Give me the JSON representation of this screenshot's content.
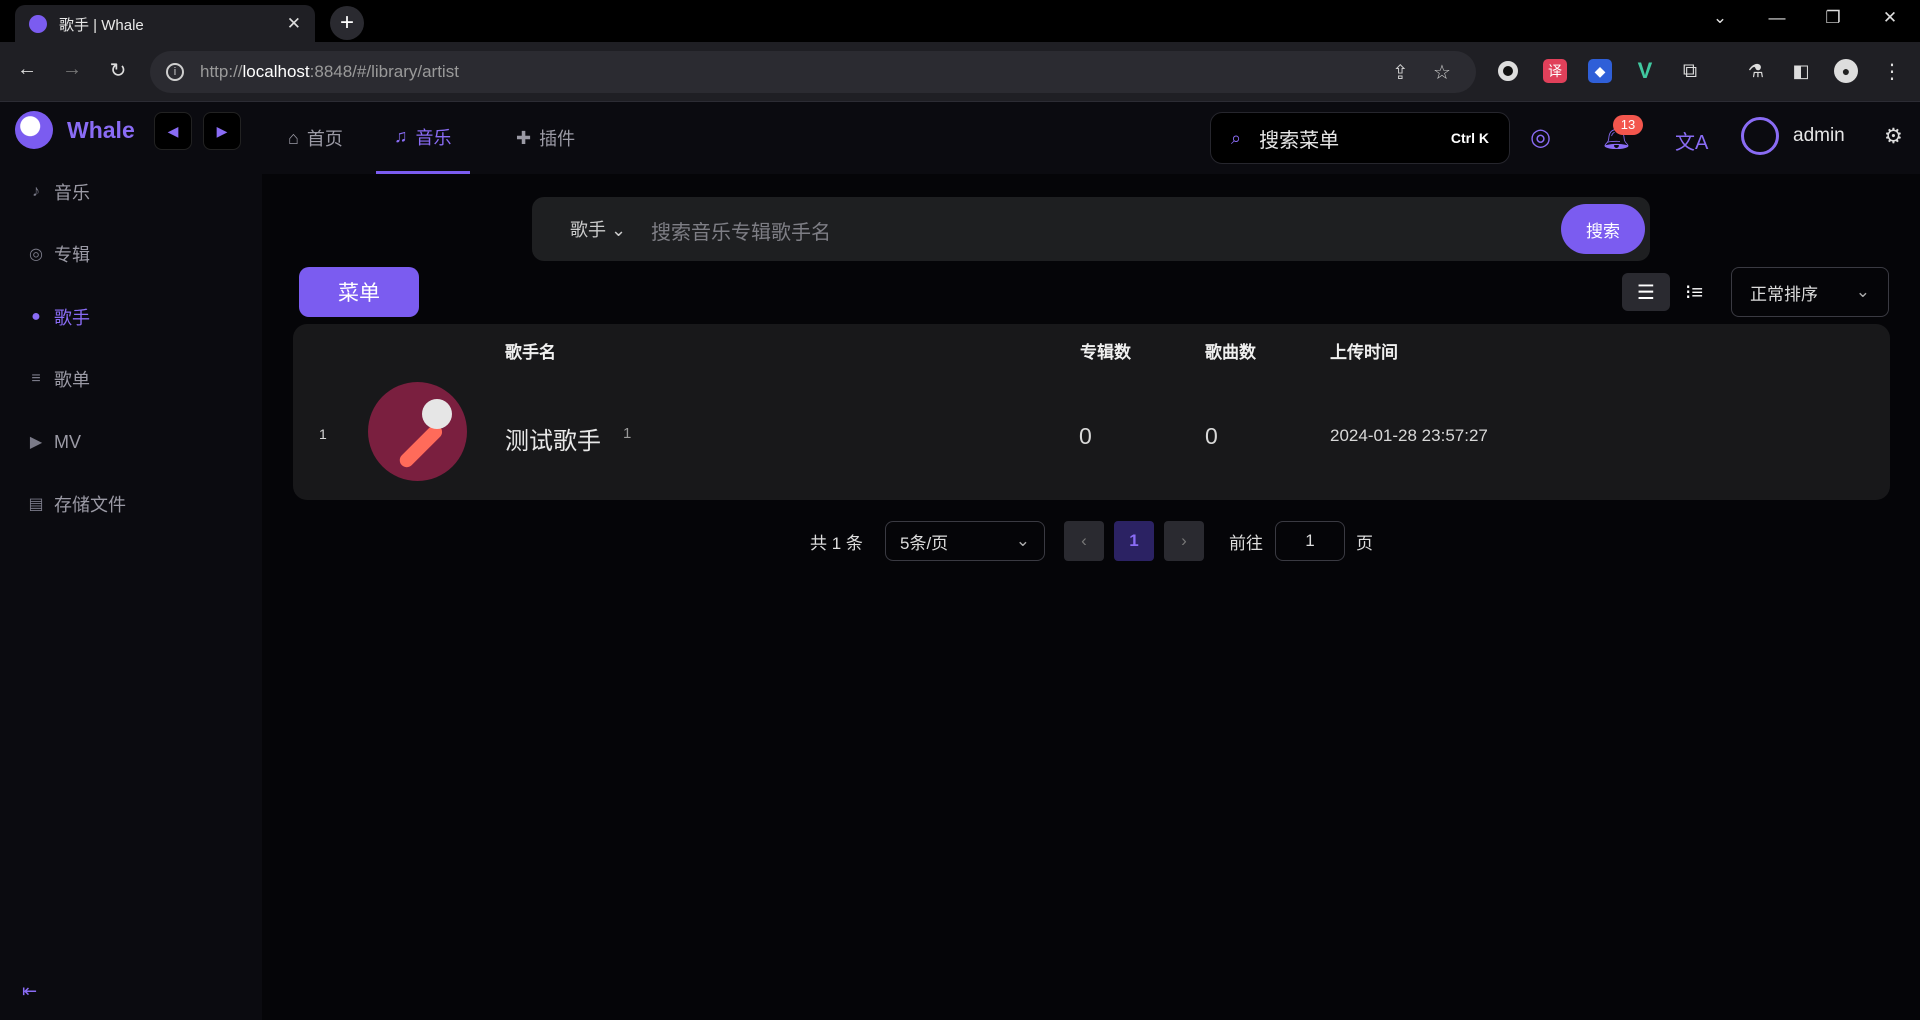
{
  "browser": {
    "tab_title": "歌手 | Whale",
    "url_proto": "http://",
    "url_host": "localhost",
    "url_rest": ":8848/#/library/artist"
  },
  "app": {
    "brand": "Whale",
    "topnav": [
      {
        "label": "首页",
        "icon": "home-icon"
      },
      {
        "label": "音乐",
        "icon": "music-icon"
      },
      {
        "label": "插件",
        "icon": "plugin-icon"
      }
    ],
    "search_menu": {
      "label": "搜索菜单",
      "shortcut": "Ctrl K"
    },
    "notifications": "13",
    "user": "admin"
  },
  "sidebar": {
    "items": [
      {
        "label": "音乐",
        "icon": "music-icon"
      },
      {
        "label": "专辑",
        "icon": "album-icon"
      },
      {
        "label": "歌手",
        "icon": "user-icon"
      },
      {
        "label": "歌单",
        "icon": "playlist-icon"
      },
      {
        "label": "MV",
        "icon": "video-icon"
      },
      {
        "label": "存储文件",
        "icon": "folder-icon"
      }
    ],
    "active": "歌手"
  },
  "search": {
    "type": "歌手",
    "placeholder": "搜索音乐专辑歌手名",
    "button": "搜索"
  },
  "toolbar": {
    "menu_button": "菜单",
    "sort": "正常排序"
  },
  "table": {
    "headers": {
      "name": "歌手名",
      "albums": "专辑数",
      "songs": "歌曲数",
      "uploaded": "上传时间"
    },
    "rows": [
      {
        "index": "1",
        "name": "测试歌手",
        "alias_count": "1",
        "albums": "0",
        "songs": "0",
        "uploaded": "2024-01-28 23:57:27"
      }
    ]
  },
  "pagination": {
    "total": "共 1 条",
    "page_size": "5条/页",
    "current": "1",
    "goto_label": "前往",
    "goto_value": "1",
    "page_suffix": "页"
  },
  "colors": {
    "accent": "#7b5cf0",
    "badge": "#f3564d",
    "background": "#050508"
  }
}
